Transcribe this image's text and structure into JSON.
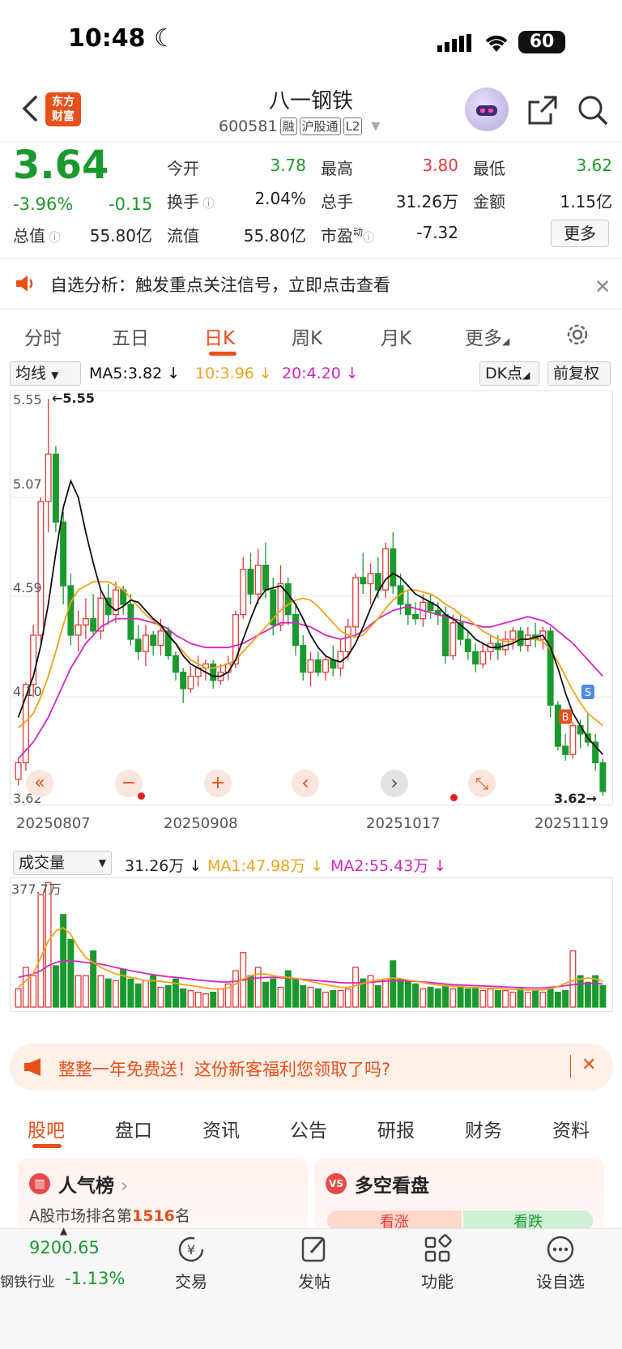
{
  "status": {
    "time": "10:48",
    "battery": "60"
  },
  "header": {
    "logo_line1": "东方",
    "logo_line2": "财富",
    "name": "八一钢铁",
    "code": "600581",
    "tags": [
      "融",
      "沪股通",
      "L2"
    ]
  },
  "quote": {
    "price": "3.64",
    "change_pct": "-3.96%",
    "change": "-0.15",
    "fields": {
      "open_label": "今开",
      "open": "3.78",
      "high_label": "最高",
      "high": "3.80",
      "low_label": "最低",
      "low": "3.62",
      "turnover_label": "换手",
      "turnover": "2.04%",
      "volume_label": "总手",
      "volume": "31.26万",
      "amount_label": "金额",
      "amount": "1.15亿",
      "mcap_label": "总值",
      "mcap": "55.80亿",
      "float_label": "流值",
      "float": "55.80亿",
      "pe_label": "市盈",
      "pe_sup": "动",
      "pe": "-7.32"
    },
    "more_label": "更多"
  },
  "alert": {
    "text": "自选分析：触发重点关注信号，立即点击查看"
  },
  "tabs": [
    "分时",
    "五日",
    "日K",
    "周K",
    "月K",
    "更多"
  ],
  "ma_row": {
    "selector": "均线",
    "ma5": "MA5:3.82",
    "ma10": "10:3.96",
    "ma20": "20:4.20",
    "dk": "DK点",
    "adjust": "前复权"
  },
  "chart_data": {
    "type": "candlestick",
    "y_ticks": [
      "5.55",
      "5.07",
      "4.59",
      "4.10",
      "3.62"
    ],
    "ylim": [
      3.62,
      5.55
    ],
    "x_ticks": [
      "20250807",
      "20250908",
      "20251017",
      "20251119"
    ],
    "max_label": "5.55",
    "min_label": "3.62",
    "markers": [
      "B",
      "S"
    ],
    "colors": {
      "up": "#e23b3b",
      "down": "#1a9a2e",
      "ma5": "#111111",
      "ma10": "#f2a31a",
      "ma20": "#d627c0"
    },
    "candles": [
      [
        3.7,
        3.8,
        3.67,
        3.78
      ],
      [
        3.78,
        4.17,
        3.74,
        4.16
      ],
      [
        4.16,
        4.45,
        4.1,
        4.4
      ],
      [
        4.4,
        5.07,
        4.35,
        5.05
      ],
      [
        5.05,
        5.55,
        4.9,
        5.28
      ],
      [
        5.28,
        5.32,
        4.9,
        4.95
      ],
      [
        4.95,
        5.0,
        4.55,
        4.64
      ],
      [
        4.64,
        4.7,
        4.35,
        4.4
      ],
      [
        4.4,
        4.52,
        4.32,
        4.45
      ],
      [
        4.45,
        4.58,
        4.38,
        4.48
      ],
      [
        4.48,
        4.6,
        4.4,
        4.42
      ],
      [
        4.42,
        4.62,
        4.38,
        4.58
      ],
      [
        4.58,
        4.65,
        4.45,
        4.5
      ],
      [
        4.5,
        4.66,
        4.46,
        4.62
      ],
      [
        4.62,
        4.64,
        4.5,
        4.55
      ],
      [
        4.55,
        4.6,
        4.35,
        4.38
      ],
      [
        4.38,
        4.45,
        4.28,
        4.32
      ],
      [
        4.32,
        4.45,
        4.25,
        4.4
      ],
      [
        4.4,
        4.42,
        4.3,
        4.35
      ],
      [
        4.35,
        4.48,
        4.3,
        4.42
      ],
      [
        4.42,
        4.44,
        4.28,
        4.3
      ],
      [
        4.3,
        4.32,
        4.18,
        4.22
      ],
      [
        4.22,
        4.24,
        4.07,
        4.14
      ],
      [
        4.14,
        4.25,
        4.12,
        4.2
      ],
      [
        4.2,
        4.3,
        4.15,
        4.24
      ],
      [
        4.24,
        4.28,
        4.18,
        4.26
      ],
      [
        4.26,
        4.28,
        4.14,
        4.18
      ],
      [
        4.18,
        4.26,
        4.16,
        4.22
      ],
      [
        4.22,
        4.3,
        4.18,
        4.26
      ],
      [
        4.26,
        4.52,
        4.24,
        4.5
      ],
      [
        4.5,
        4.78,
        4.48,
        4.72
      ],
      [
        4.72,
        4.8,
        4.55,
        4.6
      ],
      [
        4.6,
        4.82,
        4.55,
        4.74
      ],
      [
        4.74,
        4.85,
        4.58,
        4.62
      ],
      [
        4.62,
        4.68,
        4.4,
        4.45
      ],
      [
        4.45,
        4.74,
        4.42,
        4.65
      ],
      [
        4.65,
        4.68,
        4.45,
        4.5
      ],
      [
        4.5,
        4.55,
        4.3,
        4.35
      ],
      [
        4.35,
        4.4,
        4.18,
        4.22
      ],
      [
        4.22,
        4.32,
        4.15,
        4.28
      ],
      [
        4.28,
        4.32,
        4.2,
        4.22
      ],
      [
        4.22,
        4.3,
        4.18,
        4.28
      ],
      [
        4.28,
        4.35,
        4.2,
        4.24
      ],
      [
        4.24,
        4.38,
        4.2,
        4.32
      ],
      [
        4.32,
        4.48,
        4.28,
        4.44
      ],
      [
        4.44,
        4.7,
        4.4,
        4.68
      ],
      [
        4.68,
        4.8,
        4.6,
        4.65
      ],
      [
        4.65,
        4.75,
        4.55,
        4.7
      ],
      [
        4.7,
        4.78,
        4.58,
        4.62
      ],
      [
        4.62,
        4.85,
        4.58,
        4.82
      ],
      [
        4.82,
        4.9,
        4.6,
        4.64
      ],
      [
        4.64,
        4.7,
        4.5,
        4.55
      ],
      [
        4.55,
        4.62,
        4.45,
        4.5
      ],
      [
        4.5,
        4.56,
        4.45,
        4.48
      ],
      [
        4.48,
        4.6,
        4.44,
        4.56
      ],
      [
        4.56,
        4.6,
        4.48,
        4.52
      ],
      [
        4.52,
        4.56,
        4.45,
        4.5
      ],
      [
        4.5,
        4.54,
        4.26,
        4.3
      ],
      [
        4.3,
        4.5,
        4.28,
        4.46
      ],
      [
        4.46,
        4.5,
        4.35,
        4.38
      ],
      [
        4.38,
        4.42,
        4.28,
        4.32
      ],
      [
        4.32,
        4.36,
        4.22,
        4.26
      ],
      [
        4.26,
        4.36,
        4.24,
        4.32
      ],
      [
        4.32,
        4.4,
        4.28,
        4.36
      ],
      [
        4.36,
        4.4,
        4.28,
        4.33
      ],
      [
        4.33,
        4.42,
        4.3,
        4.38
      ],
      [
        4.38,
        4.44,
        4.33,
        4.42
      ],
      [
        4.42,
        4.44,
        4.32,
        4.35
      ],
      [
        4.35,
        4.44,
        4.32,
        4.4
      ],
      [
        4.4,
        4.46,
        4.34,
        4.38
      ],
      [
        4.38,
        4.44,
        4.33,
        4.42
      ],
      [
        4.42,
        4.44,
        4.0,
        4.06
      ],
      [
        4.06,
        4.08,
        3.84,
        3.86
      ],
      [
        3.86,
        3.92,
        3.79,
        3.82
      ],
      [
        3.82,
        3.98,
        3.8,
        3.96
      ],
      [
        3.96,
        3.99,
        3.85,
        3.92
      ],
      [
        3.92,
        4.02,
        3.86,
        3.88
      ],
      [
        3.88,
        3.92,
        3.74,
        3.78
      ],
      [
        3.78,
        3.8,
        3.62,
        3.64
      ]
    ],
    "ma5": [
      4.0,
      4.1,
      4.2,
      4.35,
      4.55,
      4.8,
      5.02,
      5.15,
      5.07,
      4.9,
      4.75,
      4.62,
      4.55,
      4.52,
      4.54,
      4.57,
      4.56,
      4.52,
      4.48,
      4.45,
      4.4,
      4.36,
      4.3,
      4.26,
      4.24,
      4.22,
      4.2,
      4.2,
      4.22,
      4.28,
      4.38,
      4.48,
      4.57,
      4.62,
      4.63,
      4.64,
      4.6,
      4.55,
      4.48,
      4.4,
      4.34,
      4.3,
      4.28,
      4.27,
      4.3,
      4.36,
      4.44,
      4.53,
      4.61,
      4.67,
      4.7,
      4.68,
      4.64,
      4.6,
      4.58,
      4.56,
      4.54,
      4.5,
      4.48,
      4.45,
      4.42,
      4.38,
      4.36,
      4.34,
      4.34,
      4.35,
      4.36,
      4.38,
      4.38,
      4.39,
      4.4,
      4.34,
      4.24,
      4.12,
      4.02,
      3.96,
      3.9,
      3.86,
      3.82
    ],
    "ma10": [
      3.95,
      3.98,
      4.02,
      4.1,
      4.2,
      4.32,
      4.45,
      4.56,
      4.62,
      4.64,
      4.66,
      4.66,
      4.66,
      4.64,
      4.62,
      4.58,
      4.54,
      4.5,
      4.47,
      4.44,
      4.4,
      4.36,
      4.32,
      4.28,
      4.26,
      4.24,
      4.24,
      4.25,
      4.26,
      4.28,
      4.32,
      4.36,
      4.4,
      4.44,
      4.48,
      4.52,
      4.55,
      4.57,
      4.58,
      4.57,
      4.54,
      4.5,
      4.46,
      4.42,
      4.4,
      4.39,
      4.4,
      4.44,
      4.48,
      4.53,
      4.57,
      4.6,
      4.62,
      4.62,
      4.61,
      4.6,
      4.58,
      4.55,
      4.53,
      4.5,
      4.48,
      4.45,
      4.42,
      4.4,
      4.38,
      4.37,
      4.37,
      4.38,
      4.38,
      4.38,
      4.37,
      4.33,
      4.27,
      4.2,
      4.13,
      4.07,
      4.02,
      3.99,
      3.96
    ],
    "ma20": [
      3.8,
      3.84,
      3.88,
      3.94,
      4.0,
      4.08,
      4.16,
      4.24,
      4.3,
      4.36,
      4.4,
      4.44,
      4.46,
      4.48,
      4.48,
      4.48,
      4.48,
      4.47,
      4.46,
      4.45,
      4.43,
      4.4,
      4.38,
      4.36,
      4.35,
      4.34,
      4.34,
      4.34,
      4.34,
      4.35,
      4.36,
      4.38,
      4.4,
      4.42,
      4.44,
      4.46,
      4.46,
      4.46,
      4.45,
      4.44,
      4.42,
      4.4,
      4.39,
      4.38,
      4.39,
      4.4,
      4.42,
      4.45,
      4.48,
      4.5,
      4.52,
      4.53,
      4.54,
      4.53,
      4.52,
      4.51,
      4.5,
      4.49,
      4.48,
      4.47,
      4.46,
      4.45,
      4.44,
      4.44,
      4.45,
      4.46,
      4.47,
      4.48,
      4.49,
      4.48,
      4.47,
      4.45,
      4.42,
      4.39,
      4.36,
      4.32,
      4.28,
      4.24,
      4.2
    ]
  },
  "volume": {
    "selector": "成交量",
    "value": "31.26万",
    "ma1": "MA1:47.98万",
    "ma2": "MA2:55.43万",
    "top_label": "377.7万",
    "bars": [
      55,
      120,
      95,
      340,
      377,
      125,
      280,
      205,
      95,
      95,
      170,
      95,
      85,
      80,
      115,
      85,
      70,
      80,
      95,
      60,
      65,
      85,
      55,
      50,
      45,
      40,
      45,
      55,
      70,
      110,
      165,
      95,
      120,
      75,
      85,
      60,
      110,
      85,
      65,
      60,
      55,
      45,
      50,
      50,
      55,
      120,
      85,
      95,
      65,
      85,
      140,
      85,
      80,
      70,
      55,
      60,
      55,
      65,
      55,
      60,
      55,
      60,
      50,
      55,
      50,
      50,
      45,
      55,
      45,
      50,
      45,
      55,
      45,
      50,
      170,
      95,
      75,
      95,
      65
    ],
    "ma1_line": [
      60,
      80,
      100,
      150,
      200,
      230,
      240,
      220,
      180,
      150,
      135,
      120,
      110,
      100,
      95,
      90,
      85,
      80,
      80,
      78,
      75,
      72,
      68,
      65,
      62,
      58,
      55,
      55,
      58,
      70,
      85,
      95,
      100,
      100,
      95,
      92,
      90,
      87,
      82,
      78,
      72,
      68,
      63,
      60,
      60,
      65,
      72,
      78,
      82,
      85,
      88,
      86,
      82,
      78,
      74,
      70,
      67,
      65,
      63,
      62,
      60,
      59,
      58,
      57,
      56,
      55,
      54,
      53,
      52,
      52,
      52,
      56,
      62,
      72,
      80,
      85,
      88,
      85,
      78
    ],
    "ma2_line": [
      90,
      95,
      100,
      110,
      125,
      135,
      140,
      140,
      138,
      135,
      133,
      130,
      125,
      120,
      115,
      110,
      106,
      102,
      98,
      95,
      92,
      90,
      88,
      85,
      82,
      80,
      78,
      76,
      76,
      78,
      82,
      86,
      88,
      90,
      90,
      89,
      88,
      86,
      84,
      82,
      80,
      78,
      76,
      74,
      73,
      73,
      74,
      75,
      77,
      79,
      80,
      80,
      79,
      78,
      76,
      74,
      72,
      70,
      68,
      67,
      66,
      65,
      64,
      63,
      62,
      61,
      60,
      59,
      58,
      58,
      58,
      60,
      62,
      65,
      68,
      70,
      72,
      72,
      70
    ]
  },
  "chart_controls": [
    "«",
    "−",
    "+",
    "‹",
    "›",
    "⤡"
  ],
  "promo": {
    "text": "整整一年免费送！这份新客福利您领取了吗?"
  },
  "bottom_tabs": [
    "股吧",
    "盘口",
    "资讯",
    "公告",
    "研报",
    "财务",
    "资料"
  ],
  "cards": {
    "left_title": "人气榜",
    "left_sub_prefix": "A股市场排名第",
    "left_rank": "1516",
    "left_sub_suffix": "名",
    "right_title": "多空看盘",
    "right_up": "看涨",
    "right_down": "看跌"
  },
  "bottom_nav": {
    "index_value": "9200.65",
    "index_name": "钢铁行业",
    "index_change": "-1.13%",
    "items": [
      "交易",
      "发帖",
      "功能",
      "设自选"
    ]
  }
}
